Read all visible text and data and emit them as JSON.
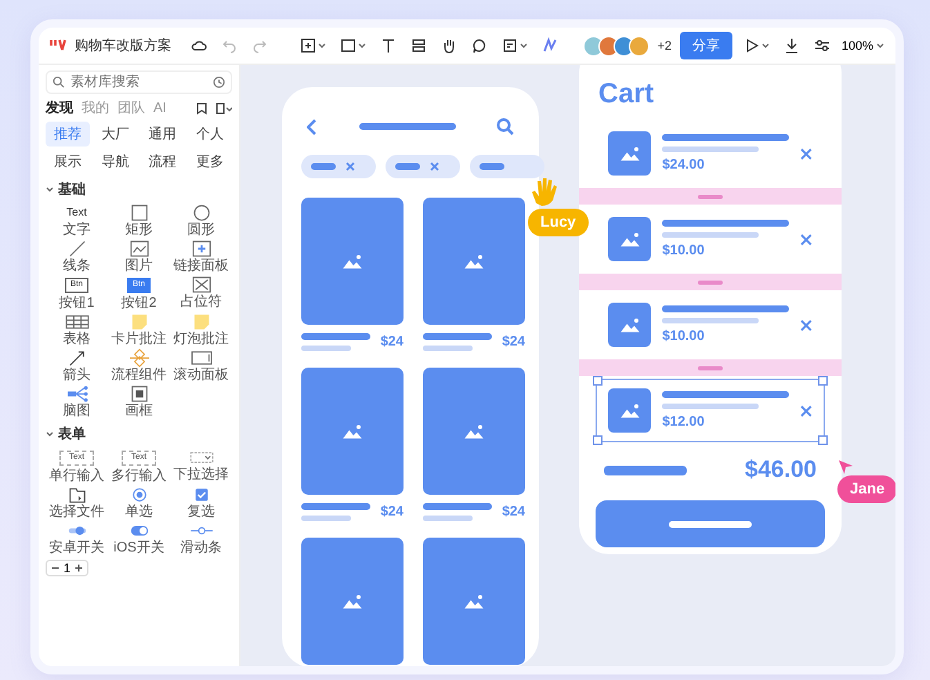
{
  "toolbar": {
    "file_title": "购物车改版方案",
    "collaborators": [
      {
        "color": "#8fc9d9"
      },
      {
        "color": "#e0783c"
      },
      {
        "color": "#3f8fd6"
      },
      {
        "color": "#e9a93c"
      }
    ],
    "collaborators_more": "+2",
    "share_button": "分享",
    "zoom": "100%"
  },
  "panel": {
    "search": {
      "placeholder": "素材库搜索"
    },
    "tabs": [
      {
        "label": "发现",
        "selected": true
      },
      {
        "label": "我的",
        "selected": false
      },
      {
        "label": "团队",
        "selected": false
      },
      {
        "label": "AI",
        "selected": false
      }
    ],
    "categories": [
      {
        "label": "推荐",
        "selected": true
      },
      {
        "label": "大厂",
        "selected": false
      },
      {
        "label": "通用",
        "selected": false
      },
      {
        "label": "个人",
        "selected": false
      },
      {
        "label": "展示",
        "selected": false
      },
      {
        "label": "导航",
        "selected": false
      },
      {
        "label": "流程",
        "selected": false
      },
      {
        "label": "更多",
        "selected": false
      }
    ],
    "sections": [
      {
        "title": "基础",
        "expanded": true,
        "items": [
          {
            "kind": "text",
            "label": "文字",
            "preview": "Text"
          },
          {
            "kind": "rect",
            "label": "矩形"
          },
          {
            "kind": "circle",
            "label": "圆形"
          },
          {
            "kind": "line",
            "label": "线条"
          },
          {
            "kind": "image",
            "label": "图片"
          },
          {
            "kind": "link",
            "label": "链接面板"
          },
          {
            "kind": "button-outline",
            "label": "按钮1",
            "preview": "Btn"
          },
          {
            "kind": "button-filled",
            "label": "按钮2",
            "preview": "Btn"
          },
          {
            "kind": "placeholder",
            "label": "占位符"
          },
          {
            "kind": "table",
            "label": "表格"
          },
          {
            "kind": "note",
            "label": "卡片批注"
          },
          {
            "kind": "note",
            "label": "灯泡批注"
          },
          {
            "kind": "arrow",
            "label": "箭头"
          },
          {
            "kind": "component",
            "label": "流程组件"
          },
          {
            "kind": "scroll",
            "label": "滚动面板"
          },
          {
            "kind": "mindmap",
            "label": "脑图"
          },
          {
            "kind": "frame",
            "label": "画框"
          }
        ]
      },
      {
        "title": "表单",
        "expanded": true,
        "items": [
          {
            "kind": "input",
            "label": "单行输入",
            "preview": "Text"
          },
          {
            "kind": "input",
            "label": "多行输入",
            "preview": "Text"
          },
          {
            "kind": "select",
            "label": "下拉选择"
          },
          {
            "kind": "file",
            "label": "选择文件"
          },
          {
            "kind": "radio",
            "label": "单选"
          },
          {
            "kind": "checkbox",
            "label": "复选"
          },
          {
            "kind": "switch",
            "label": "安卓开关"
          },
          {
            "kind": "switch-ios",
            "label": "iOS开关"
          },
          {
            "kind": "slider",
            "label": "滑动条"
          }
        ]
      }
    ],
    "pager": "1"
  },
  "canvas": {
    "product_screen": {
      "filters": [
        {
          "removable": true
        },
        {
          "removable": true
        },
        {
          "removable": false
        }
      ],
      "products": [
        {
          "kind": "card",
          "price": "$24"
        },
        {
          "kind": "card",
          "price": "$24"
        },
        {
          "kind": "card",
          "price": "$24"
        },
        {
          "kind": "card",
          "price": "$24"
        },
        {
          "kind": "picture"
        },
        {
          "kind": "picture"
        }
      ]
    },
    "cart_screen": {
      "title": "Cart",
      "items": [
        {
          "price": "$24.00",
          "selected": false
        },
        {
          "price": "$10.00",
          "selected": false
        },
        {
          "price": "$10.00",
          "selected": false
        },
        {
          "price": "$12.00",
          "selected": true
        }
      ],
      "total": "$46.00"
    },
    "cursors": [
      {
        "name": "Lucy",
        "color": "#f7b500",
        "kind": "hand"
      },
      {
        "name": "Jane",
        "color": "#f0509a",
        "kind": "arrow"
      }
    ]
  }
}
